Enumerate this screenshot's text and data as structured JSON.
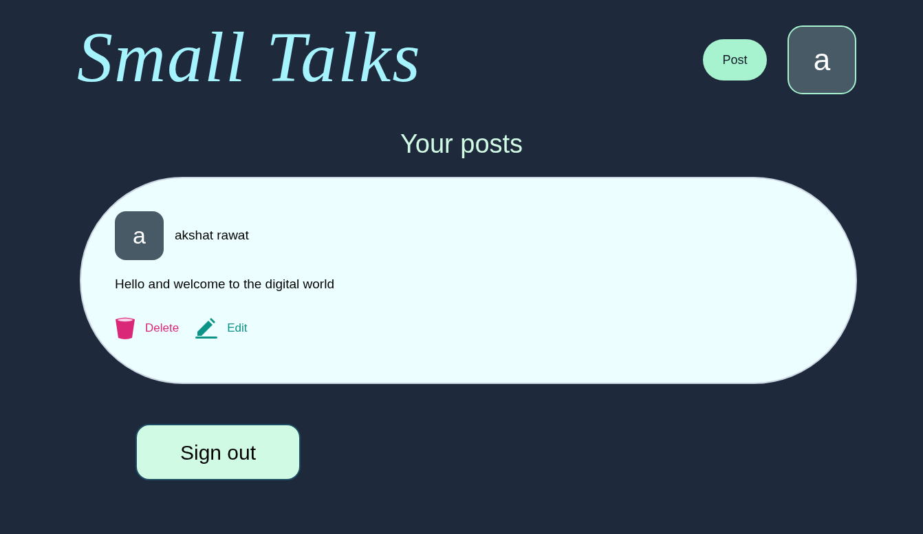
{
  "header": {
    "logo": "Small Talks",
    "post_button": "Post",
    "avatar_letter": "a"
  },
  "heading": "Your posts",
  "posts": [
    {
      "avatar_letter": "a",
      "author": "akshat rawat",
      "content": "Hello and welcome to the digital world",
      "actions": [
        {
          "kind": "delete",
          "label": "Delete"
        },
        {
          "kind": "edit",
          "label": "Edit"
        }
      ]
    }
  ],
  "sign_out": "Sign out"
}
